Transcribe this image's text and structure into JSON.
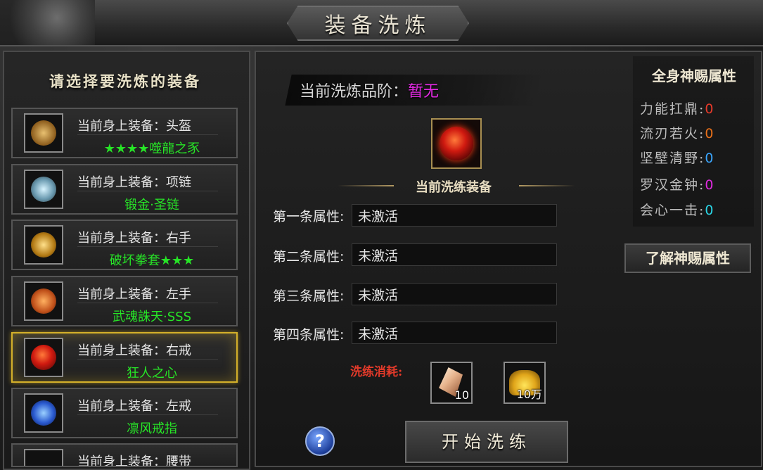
{
  "window": {
    "title": "装备洗炼"
  },
  "left_panel": {
    "header": "请选择要洗炼的装备",
    "items": [
      {
        "slot_line": "当前身上装备：头盔",
        "name": "★★★★噬龍之豕",
        "icon": "helmet-icon",
        "selected": false
      },
      {
        "slot_line": "当前身上装备：项链",
        "name": "锻金·圣链",
        "icon": "necklace-icon",
        "selected": false
      },
      {
        "slot_line": "当前身上装备：右手",
        "name": "破坏拳套★★★",
        "icon": "gauntlet-icon",
        "selected": false
      },
      {
        "slot_line": "当前身上装备：左手",
        "name": "武魂誅天·SSS",
        "icon": "glove-icon",
        "selected": false
      },
      {
        "slot_line": "当前身上装备：右戒",
        "name": "狂人之心",
        "icon": "ring-icon",
        "selected": true
      },
      {
        "slot_line": "当前身上装备：左戒",
        "name": "凛风戒指",
        "icon": "ring-blue-icon",
        "selected": false
      },
      {
        "slot_line": "当前身上装备：腰带",
        "name": "",
        "icon": "belt-icon",
        "selected": false
      }
    ]
  },
  "main": {
    "grade_label": "当前洗炼品阶：",
    "grade_value": "暂无",
    "current_label": "当前洗练装备",
    "attributes": [
      {
        "label": "第一条属性:",
        "value": "未激活"
      },
      {
        "label": "第二条属性:",
        "value": "未激活"
      },
      {
        "label": "第三条属性:",
        "value": "未激活"
      },
      {
        "label": "第四条属性:",
        "value": "未激活"
      }
    ],
    "cost_label": "洗练消耗:",
    "costs": [
      {
        "icon": "crystal-icon",
        "count": "10"
      },
      {
        "icon": "gold-coins-icon",
        "count": "10万"
      }
    ],
    "start_button": "开始洗练",
    "help_icon": "?"
  },
  "divine": {
    "title": "全身神赐属性",
    "rows": [
      {
        "label": "力能扛鼎:",
        "value": "0",
        "color": "#e83a2a"
      },
      {
        "label": "流刃若火:",
        "value": "0",
        "color": "#e8701a"
      },
      {
        "label": "坚壁清野:",
        "value": "0",
        "color": "#3aa6ff"
      },
      {
        "label": "罗汉金钟:",
        "value": "0",
        "color": "#e02ae0"
      },
      {
        "label": "会心一击:",
        "value": "0",
        "color": "#2ad6e6"
      }
    ],
    "learn_button": "了解神赐属性"
  }
}
